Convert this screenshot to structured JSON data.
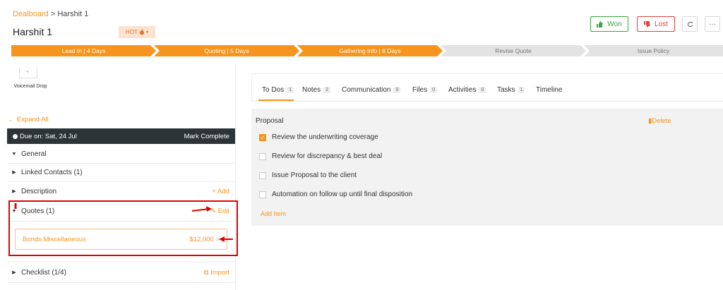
{
  "breadcrumb": {
    "root": "Dealboard",
    "sep": ">",
    "current": "Harshit 1"
  },
  "deal": {
    "title": "Harshit 1",
    "hot_label": "HOT",
    "hot_icon": "flame-icon"
  },
  "actions": {
    "won": "Won",
    "lost": "Lost",
    "refresh_icon": "refresh-icon",
    "more_label": "···"
  },
  "pipeline": [
    {
      "label": "Lead In | 4 Days",
      "status": "done"
    },
    {
      "label": "Quoting | 5 Days",
      "status": "done"
    },
    {
      "label": "Gathering Info | 8 Days",
      "status": "done"
    },
    {
      "label": "Revise Quote",
      "status": "todo"
    },
    {
      "label": "Issue Policy",
      "status": "todo"
    }
  ],
  "left": {
    "voicemail": "Voicemail Drop",
    "expand_all": "Expand All",
    "due": "Due on: Sat, 24 Jul",
    "mark_complete": "Mark Complete",
    "sections": {
      "general": "General",
      "linked": "Linked Contacts (1)",
      "description": "Description",
      "add": "+ Add",
      "quotes": "Quotes (1)",
      "edit": "Edit",
      "checklist": "Checklist (1/4)",
      "import": "Import"
    },
    "quote": {
      "name": "Bonds Miscellaneous",
      "amount": "$12,000",
      "chev": ">"
    }
  },
  "tabs": [
    {
      "label": "To Dos",
      "count": "1"
    },
    {
      "label": "Notes",
      "count": "2"
    },
    {
      "label": "Communication",
      "count": "0"
    },
    {
      "label": "Files",
      "count": "0"
    },
    {
      "label": "Activities",
      "count": "0"
    },
    {
      "label": "Tasks",
      "count": "1"
    },
    {
      "label": "Timeline",
      "count": ""
    }
  ],
  "proposal": {
    "title": "Proposal",
    "delete": "Delete",
    "items": [
      {
        "label": "Review the underwriting coverage",
        "checked": true
      },
      {
        "label": "Review for discrepancy & best deal",
        "checked": false
      },
      {
        "label": "Issue Proposal to the client",
        "checked": false
      },
      {
        "label": "Automation on follow up until final disposition",
        "checked": false
      }
    ],
    "add_item": "Add Item"
  },
  "colors": {
    "accent": "#f7941d",
    "dark": "#2d3438",
    "won": "#3aa53a",
    "lost": "#e04040",
    "annotation": "#e00000"
  }
}
